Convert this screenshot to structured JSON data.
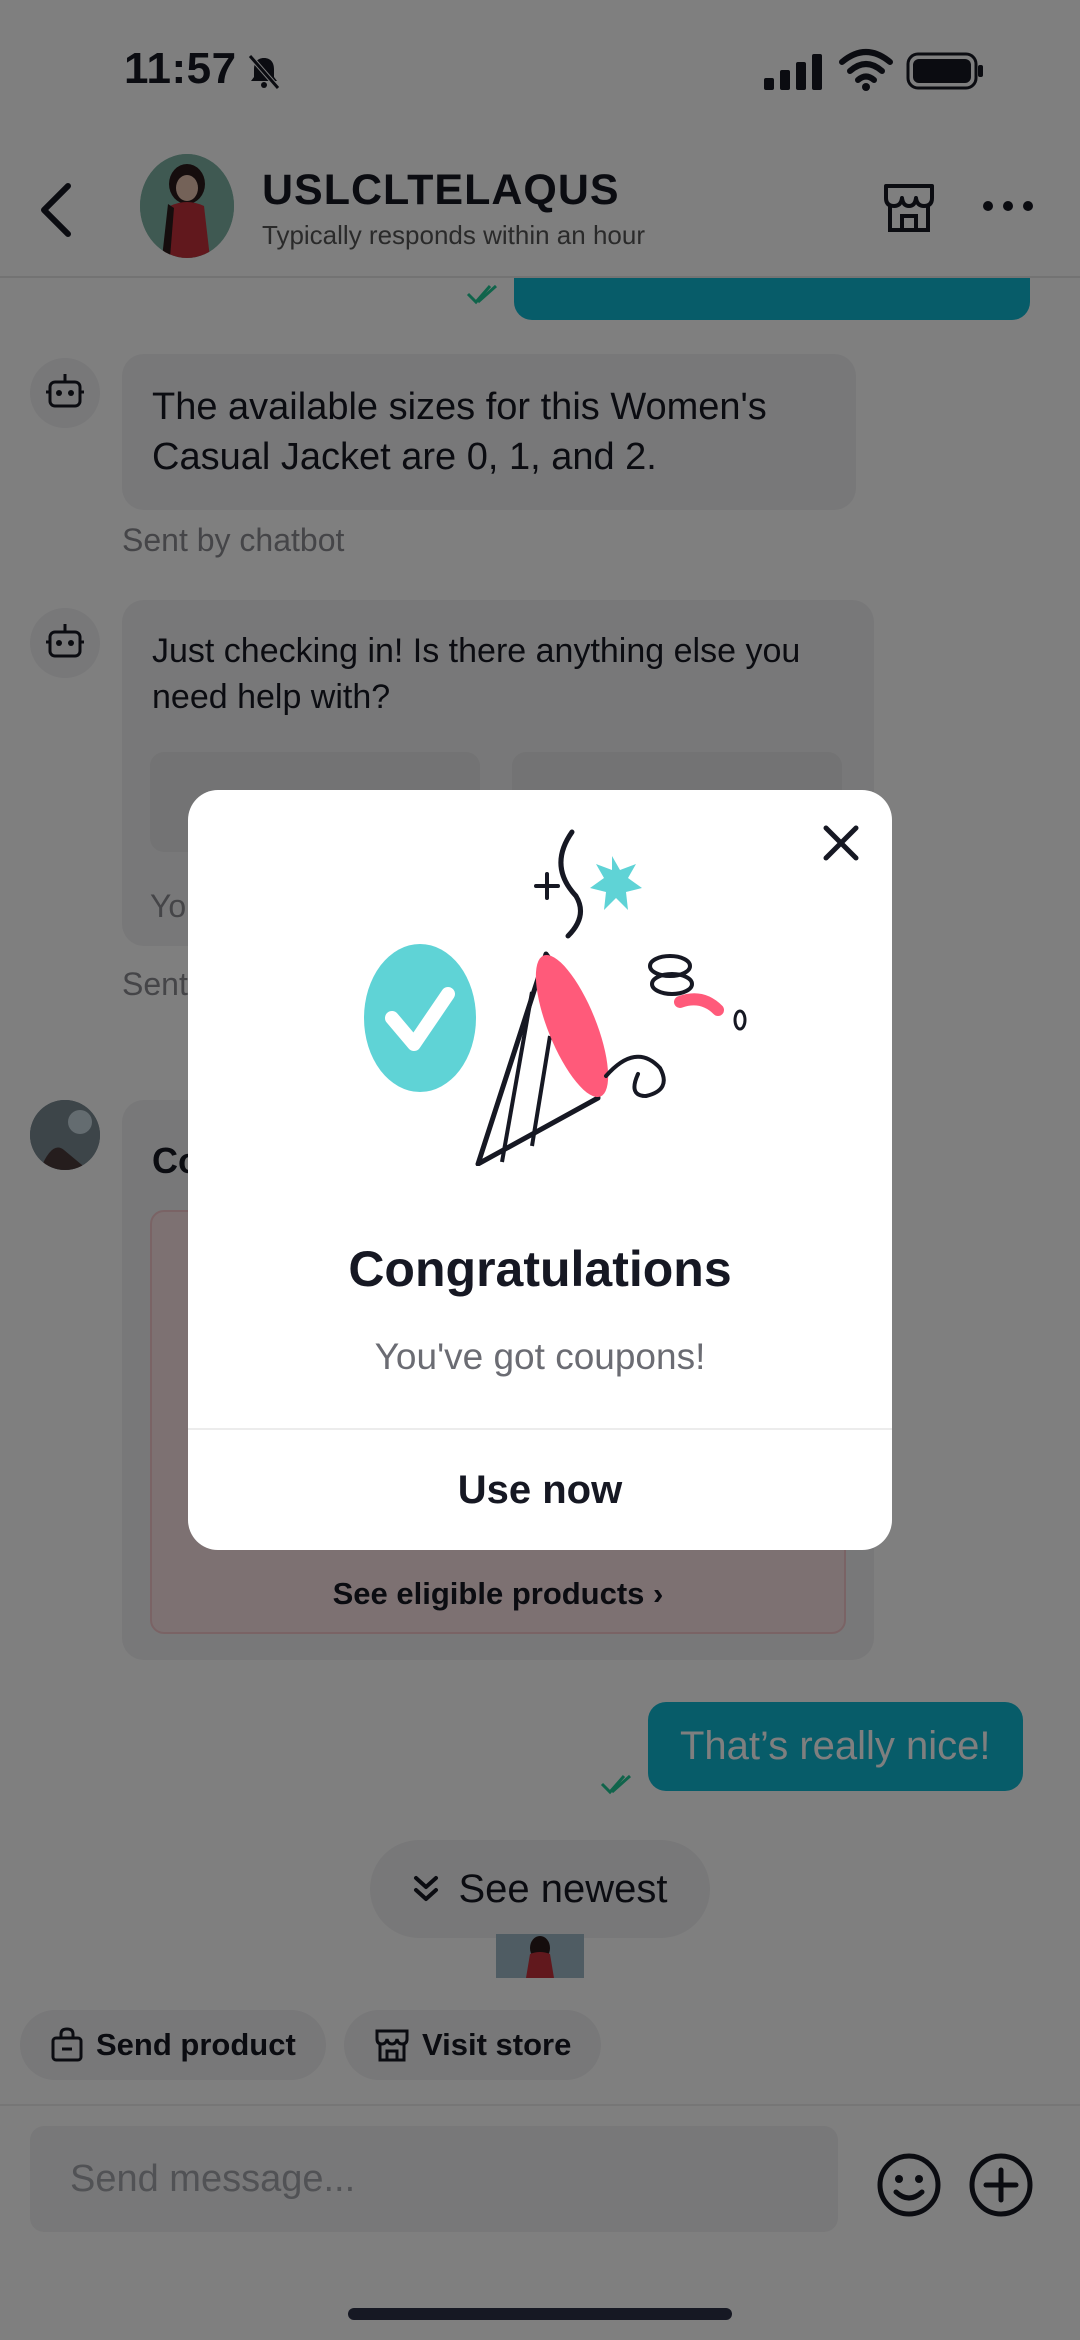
{
  "status_bar": {
    "time": "11:57"
  },
  "header": {
    "shop_name": "USLCLTELAQUS",
    "subtitle": "Typically responds within an hour"
  },
  "messages": {
    "bot_message_1": "The available sizes for this Women's Casual Jacket are 0, 1, and 2.",
    "bot_meta_1": "Sent by chatbot",
    "bot_message_2": "Just checking in! Is there anything else you need help with?",
    "bot_partial_1": "Yo",
    "bot_meta_2_partial": "Sent",
    "coupon_title_partial": "Co",
    "coupon_see_eligible": "See eligible products ›",
    "user_message": "That’s really nice!",
    "see_newest": "See newest"
  },
  "actions": {
    "send_product": "Send product",
    "visit_store": "Visit store"
  },
  "composer": {
    "placeholder": "Send message..."
  },
  "modal": {
    "title": "Congratulations",
    "subtitle": "You've got coupons!",
    "button": "Use now"
  },
  "colors": {
    "accent": "#0fb9d3",
    "tick": "#20c997",
    "confetti_pink": "#ff5a7a",
    "confetti_teal": "#5fd3d6"
  }
}
